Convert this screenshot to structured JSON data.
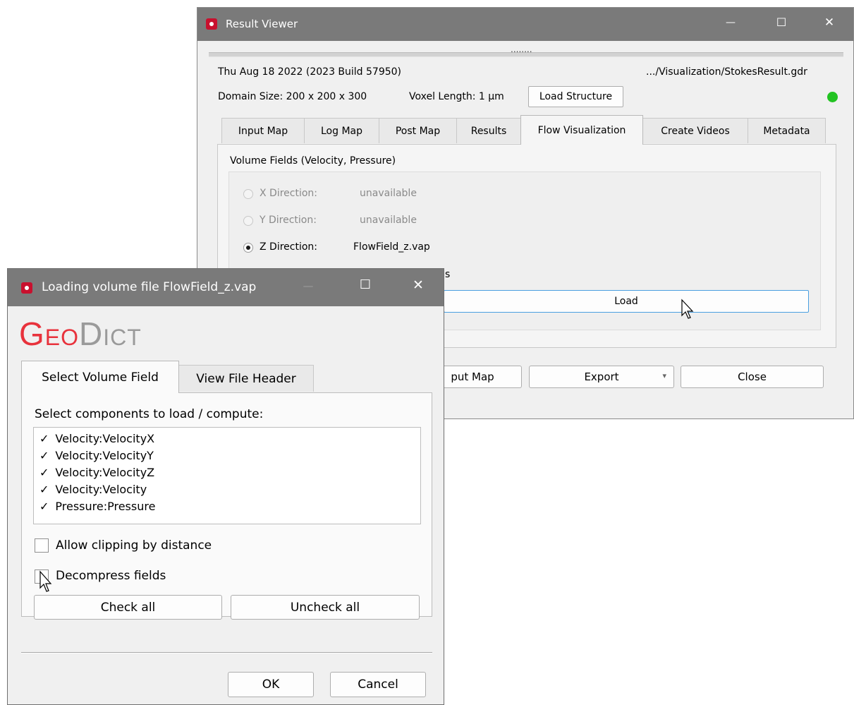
{
  "result_viewer": {
    "title": "Result Viewer",
    "controls": {
      "minimize": "—",
      "maximize": "☐",
      "close": "✕"
    },
    "splitter_grip": "........",
    "date_line": "Thu Aug 18 2022 (2023 Build 57950)",
    "file_path": ".../Visualization/StokesResult.gdr",
    "domain_size": "Domain Size: 200 x 200 x 300",
    "voxel_length": "Voxel Length: 1 µm",
    "load_structure_label": "Load Structure",
    "status_color": "#22c322",
    "tabs": [
      {
        "label": "Input Map"
      },
      {
        "label": "Log Map"
      },
      {
        "label": "Post Map"
      },
      {
        "label": "Results"
      },
      {
        "label": "Flow Visualization",
        "active": true
      },
      {
        "label": "Create Videos"
      },
      {
        "label": "Metadata"
      }
    ],
    "group_title": "Volume Fields (Velocity, Pressure)",
    "radios": [
      {
        "label": "X Direction:",
        "value": "unavailable",
        "enabled": false,
        "checked": false
      },
      {
        "label": "Y Direction:",
        "value": "unavailable",
        "enabled": false,
        "checked": false
      },
      {
        "label": "Z Direction:",
        "value": "FlowField_z.vap",
        "enabled": true,
        "checked": true
      }
    ],
    "partial_text": "s",
    "load_label": "Load",
    "bottom_buttons": {
      "input_map": "put Map",
      "export": "Export",
      "export_arrow": "▾",
      "close": "Close"
    }
  },
  "loading_dialog": {
    "title": "Loading volume file FlowField_z.vap",
    "controls": {
      "minimize": "—",
      "maximize": "☐",
      "close": "✕"
    },
    "logo": {
      "part1": "Geo",
      "part2": "Dict"
    },
    "tabs": [
      {
        "label": "Select Volume Field",
        "active": true
      },
      {
        "label": "View File Header"
      }
    ],
    "section_label": "Select components to load / compute:",
    "components": [
      {
        "label": "Velocity:VelocityX",
        "checked": true
      },
      {
        "label": "Velocity:VelocityY",
        "checked": true
      },
      {
        "label": "Velocity:VelocityZ",
        "checked": true
      },
      {
        "label": "Velocity:Velocity",
        "checked": true
      },
      {
        "label": "Pressure:Pressure",
        "checked": true
      }
    ],
    "check_mark": "✓",
    "allow_clipping_label": "Allow clipping by distance",
    "decompress_label": "Decompress fields",
    "check_all_label": "Check all",
    "uncheck_all_label": "Uncheck all",
    "ok_label": "OK",
    "cancel_label": "Cancel"
  },
  "colors": {
    "brand_red": "#e8323c",
    "brand_gray": "#9a9a9a",
    "titlebar": "#7a7a7a"
  }
}
